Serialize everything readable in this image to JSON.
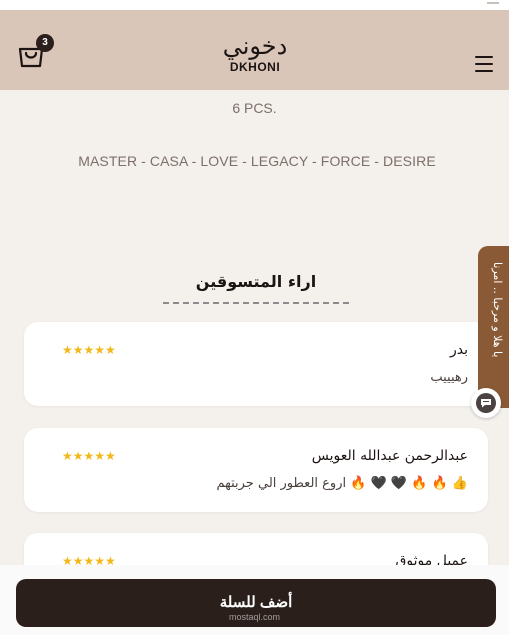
{
  "header": {
    "cart_count": "3",
    "logo_ar": "دخوني",
    "logo_en": "DKHONI"
  },
  "product": {
    "pieces": "6 PCS.",
    "collections": "MASTER - CASA - LOVE - LEGACY - FORCE - DESIRE"
  },
  "reviews": {
    "title": "اراء المتسوقين",
    "items": [
      {
        "name": "بدر",
        "stars": "★★★★★",
        "text": "رهيييب"
      },
      {
        "name": "عبدالرحمن عبدالله العويس",
        "stars": "★★★★★",
        "text": "👍 🔥 🔥 🖤 🖤 🔥 اروع العطور الي جربتهم"
      },
      {
        "name": "عميل موثوق",
        "stars": "★★★★★",
        "text": ""
      }
    ]
  },
  "chat": {
    "tab_label": "يا هلا و مرحبا .. امرنا"
  },
  "cta": {
    "add_to_cart": "أضف للسلة"
  },
  "watermark": "mostaql.com",
  "colors": {
    "header_bg": "#d9c6b8",
    "page_bg": "#f4f0ec",
    "button_bg": "#2b1f1c",
    "star": "#f2b81a",
    "chat_tab": "#8a5a36"
  },
  "icons": {
    "cart": "shopping-bag-icon",
    "menu": "hamburger-menu-icon",
    "chat": "chat-bubble-icon"
  }
}
